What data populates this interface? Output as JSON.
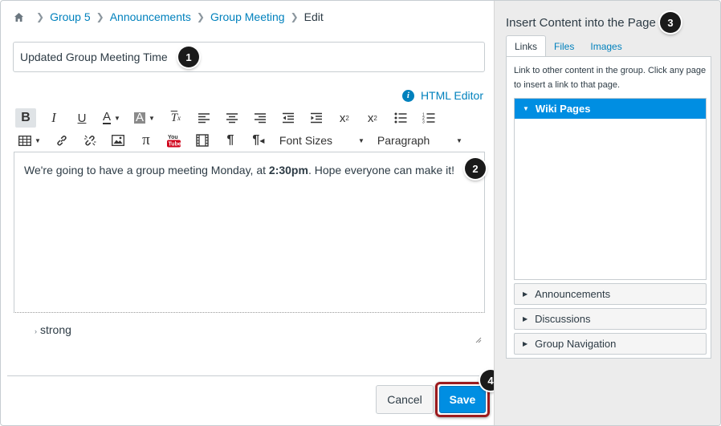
{
  "breadcrumb": {
    "items": [
      "Group 5",
      "Announcements",
      "Group Meeting"
    ],
    "current": "Edit"
  },
  "title_input": {
    "value": "Updated Group Meeting Time"
  },
  "html_editor": {
    "label": "HTML Editor"
  },
  "toolbar": {
    "font_sizes_label": "Font Sizes",
    "paragraph_label": "Paragraph"
  },
  "editor": {
    "text_before": "We're going to have a group meeting Monday, at ",
    "text_bold": "2:30pm",
    "text_after": ". Hope everyone can make it!"
  },
  "statusbar": {
    "path": "strong"
  },
  "actions": {
    "cancel_label": "Cancel",
    "save_label": "Save"
  },
  "panel": {
    "title": "Insert Content into the Page",
    "tabs": [
      "Links",
      "Files",
      "Images"
    ],
    "description": "Link to other content in the group. Click any page to insert a link to that page.",
    "open_section": "Wiki Pages",
    "sections": [
      "Announcements",
      "Discussions",
      "Group Navigation"
    ]
  },
  "callouts": [
    "1",
    "2",
    "3",
    "4"
  ],
  "colors": {
    "link": "#0081bd",
    "save_button": "#008ee2",
    "save_ring": "#9b1b1f"
  }
}
